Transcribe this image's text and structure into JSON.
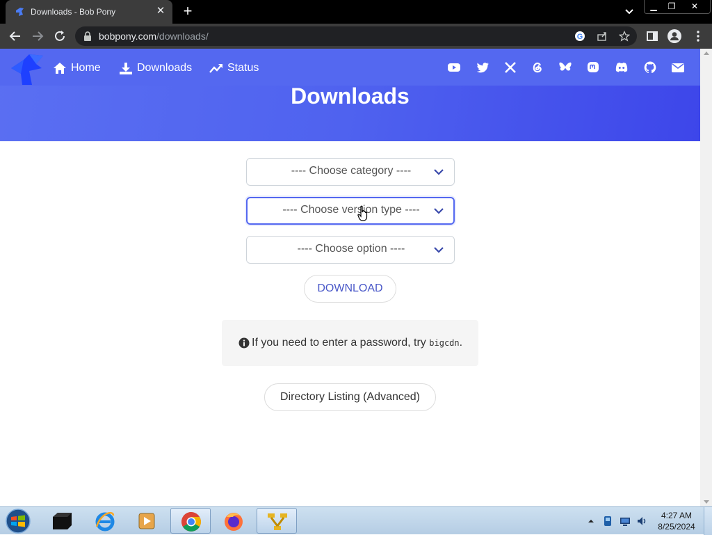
{
  "browser": {
    "tab_title": "Downloads - Bob Pony",
    "url_host": "bobpony.com",
    "url_path": "/downloads/"
  },
  "site": {
    "nav": [
      {
        "label": "Home",
        "icon": "home-icon"
      },
      {
        "label": "Downloads",
        "icon": "download-icon"
      },
      {
        "label": "Status",
        "icon": "trending-icon"
      }
    ],
    "social_icons": [
      "youtube-icon",
      "twitter-icon",
      "x-icon",
      "threads-icon",
      "bluesky-icon",
      "mastodon-icon",
      "discord-icon",
      "github-icon",
      "mail-icon"
    ],
    "accent_color": "#5468f0"
  },
  "page": {
    "title": "Downloads",
    "selects": [
      {
        "value": "---- Choose category ----"
      },
      {
        "value": "---- Choose version type ----"
      },
      {
        "value": "---- Choose option ----"
      }
    ],
    "download_label": "DOWNLOAD",
    "note_prefix": "If you need to enter a password, try",
    "note_code": "bigcdn",
    "note_suffix": ".",
    "directory_label": "Directory Listing (Advanced)"
  },
  "taskbar": {
    "apps": [
      "command-prompt",
      "internet-explorer",
      "media-player",
      "chrome",
      "firefox",
      "network-app"
    ],
    "time": "4:27 AM",
    "date": "8/25/2024"
  }
}
